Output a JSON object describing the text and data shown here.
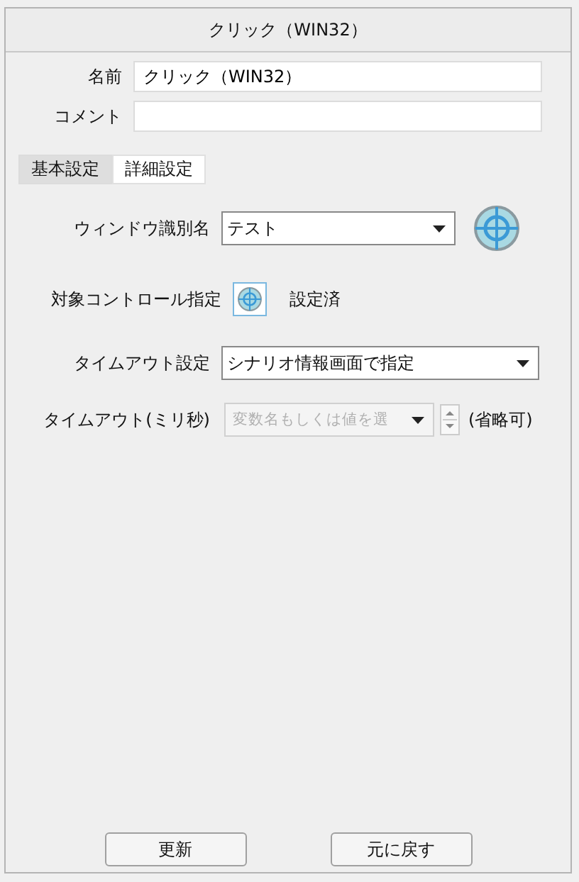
{
  "header": {
    "title": "クリック（WIN32）"
  },
  "fields": [
    {
      "label": "名前",
      "value": "クリック（WIN32）"
    },
    {
      "label": "コメント"
    }
  ],
  "tabs": [
    {
      "label": "基本設定",
      "selected": true
    },
    {
      "label": "詳細設定",
      "selected": false
    }
  ],
  "window_id": {
    "label": "ウィンドウ識別名",
    "value": "テスト"
  },
  "target_control": {
    "label": "対象コントロール指定",
    "status": "設定済"
  },
  "timeout_setting": {
    "label": "タイムアウト設定",
    "value": "シナリオ情報画面で指定"
  },
  "timeout_ms": {
    "label": "タイムアウト(ミリ秒)",
    "placeholder": "変数名もしくは値を選",
    "disabled": true,
    "note": "(省略可)"
  },
  "buttons": [
    {
      "label": "更新"
    },
    {
      "label": "元に戻す"
    }
  ]
}
